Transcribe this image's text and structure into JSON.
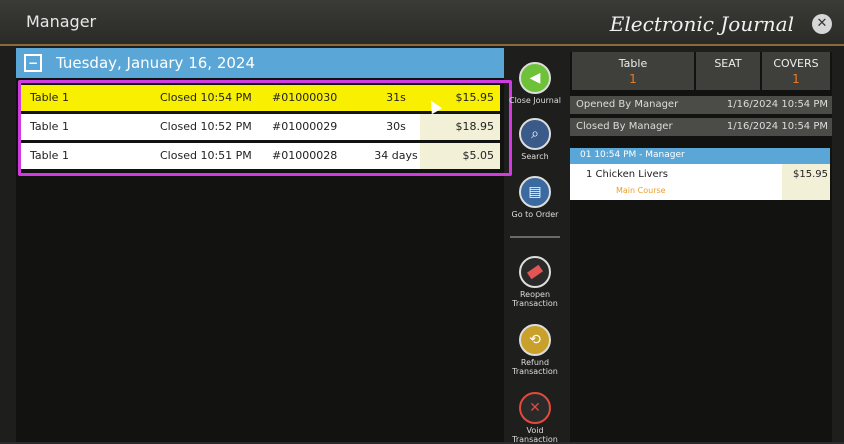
{
  "window": {
    "title_left": "Manager",
    "title_right": "Electronic Journal",
    "close_glyph": "✕"
  },
  "journal": {
    "date": "Tuesday, January 16, 2024",
    "collapse_glyph": "−",
    "rows": [
      {
        "table": "Table 1",
        "status": "Closed 10:54 PM",
        "number": "#01000030",
        "duration": "31s",
        "amount": "$15.95"
      },
      {
        "table": "Table 1",
        "status": "Closed 10:52 PM",
        "number": "#01000029",
        "duration": "30s",
        "amount": "$18.95"
      },
      {
        "table": "Table 1",
        "status": "Closed 10:51 PM",
        "number": "#01000028",
        "duration": "34 days",
        "amount": "$5.05"
      }
    ]
  },
  "tools": {
    "close_journal": "Close Journal",
    "search": "Search",
    "go_to_order": "Go to Order",
    "reopen": "Reopen Transaction",
    "refund": "Refund Transaction",
    "void": "Void Transaction"
  },
  "details": {
    "table_label": "Table",
    "table_value": "1",
    "seat_label": "SEAT",
    "covers_label": "COVERS",
    "covers_value": "1",
    "opened_label": "Opened By Manager",
    "opened_value": "1/16/2024 10:54 PM",
    "closed_label": "Closed By Manager",
    "closed_value": "1/16/2024 10:54 PM",
    "order_header": "01  10:54 PM - Manager",
    "item_name": "1  Chicken Livers",
    "item_price": "$15.95",
    "item_course": "Main Course"
  }
}
